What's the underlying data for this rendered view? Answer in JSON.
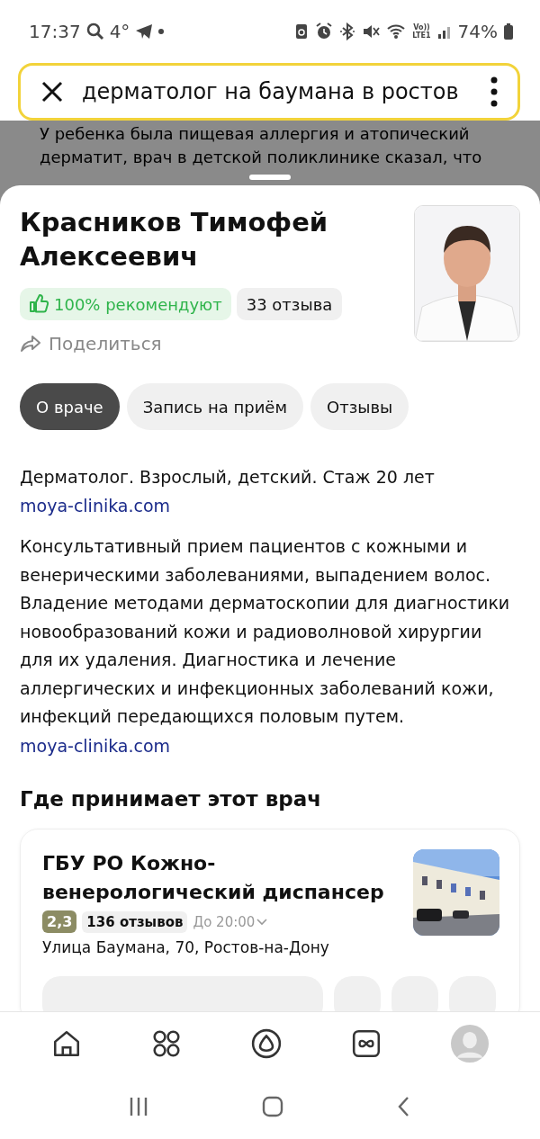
{
  "status_bar": {
    "time": "17:37",
    "temperature": "4°",
    "volte": "Vo))",
    "network": "LTE1",
    "battery": "74%"
  },
  "search": {
    "value": "дерматолог на баумана в ростов"
  },
  "background_text": "У ребенка была пищевая аллергия и атопический дерматит, врач в детской поликлинике сказал, что",
  "doctor": {
    "name": "Красников Тимофей Алексеевич",
    "recommend": "100% рекомендуют",
    "reviews": "33 отзыва",
    "share": "Поделиться"
  },
  "tabs": [
    {
      "label": "О враче",
      "selected": true
    },
    {
      "label": "Запись на приём",
      "selected": false
    },
    {
      "label": "Отзывы",
      "selected": false
    }
  ],
  "about": {
    "specialty": "Дерматолог. Взрослый, детский. Стаж 20 лет",
    "site": "moya-clinika.com",
    "description": "Консультативный прием пациентов с кожными и венерическими заболеваниями, выпадением волос. Владение методами дерматоскопии для диагностики новообразований кожи и радиоволновой хирургии для их удаления. Диагностика и лечение аллергических и инфекционных заболеваний кожи, инфекций передающихся половым путем.",
    "description_link": "moya-clinika.com"
  },
  "places": {
    "heading": "Где принимает этот врач",
    "clinics": [
      {
        "name": "ГБУ РО Кожно-венерологический диспансер",
        "rating": "2,3",
        "reviews": "136 отзывов",
        "hours": "До 20:00",
        "address": "Улица Баумана, 70, Ростов-на-Дону"
      }
    ]
  },
  "bottom_nav": [
    {
      "kind": "home"
    },
    {
      "kind": "services"
    },
    {
      "kind": "assistant"
    },
    {
      "kind": "infinity"
    },
    {
      "kind": "profile"
    }
  ],
  "system_nav": [
    {
      "kind": "recent"
    },
    {
      "kind": "home"
    },
    {
      "kind": "back"
    }
  ]
}
